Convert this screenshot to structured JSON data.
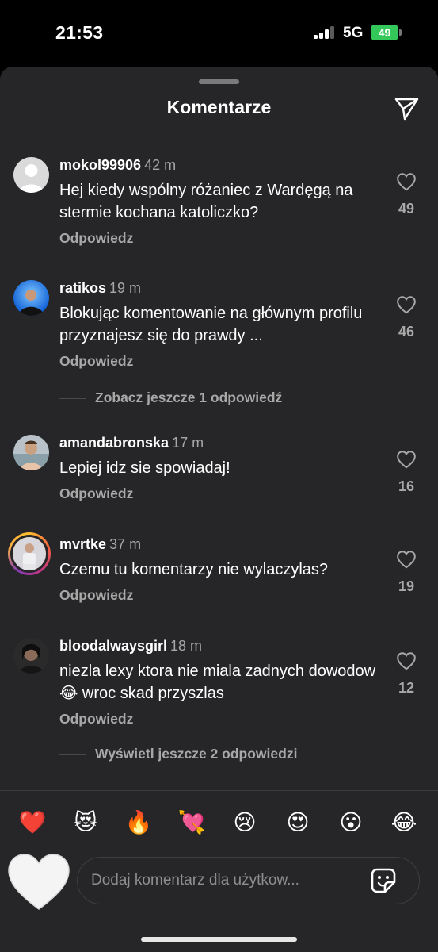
{
  "status_bar": {
    "time": "21:53",
    "network": "5G",
    "battery": "49"
  },
  "header": {
    "title": "Komentarze"
  },
  "comments": [
    {
      "username": "mokol99906",
      "time": "42 m",
      "text": "Hej kiedy wspólny różaniec z Wardęgą na stermie kochana katoliczko?",
      "reply_label": "Odpowiedz",
      "likes": "49"
    },
    {
      "username": "ratikos",
      "time": "19 m",
      "text": "Blokując komentowanie na głównym profilu przyznajesz się do prawdy ...",
      "reply_label": "Odpowiedz",
      "likes": "46"
    },
    {
      "username": "amandabronska",
      "time": "17 m",
      "text": "Lepiej idz sie spowiadaj!",
      "reply_label": "Odpowiedz",
      "likes": "16"
    },
    {
      "username": "mvrtke",
      "time": "37 m",
      "text": "Czemu tu komentarzy nie wylaczylas?",
      "reply_label": "Odpowiedz",
      "likes": "19"
    },
    {
      "username": "bloodalwaysgirl",
      "time": "18 m",
      "text": "niezla lexy ktora nie miala zadnych dowodow 😂 wroc skad przyszlas",
      "reply_label": "Odpowiedz",
      "likes": "12"
    }
  ],
  "more_replies": [
    "Zobacz jeszcze 1 odpowiedź",
    "Wyświetl jeszcze 2 odpowiedzi"
  ],
  "quick_reactions": [
    "❤️",
    "😻",
    "🔥",
    "💘",
    "😢",
    "😍",
    "😮",
    "😂"
  ],
  "composer": {
    "placeholder": "Dodaj komentarz dla użytkow..."
  },
  "colors": {
    "background": "#262628",
    "muted_text": "#a8a8a8",
    "battery": "#34c759"
  }
}
